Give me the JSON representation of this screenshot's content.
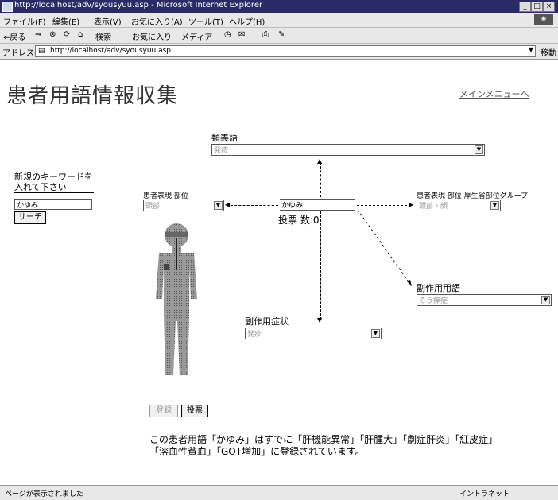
{
  "window": {
    "title": "http://localhost/adv/syousyuu.asp - Microsoft Internet Explorer",
    "menu": [
      "ファイル(F)",
      "編集(E)",
      "表示(V)",
      "お気に入り(A)",
      "ツール(T)",
      "ヘルプ(H)"
    ],
    "toolbar": [
      "⇐戻る",
      "⇒",
      "検索",
      "お気に入り",
      "メディア"
    ],
    "address_label": "アドレス(D)",
    "url": "http://localhost/adv/syousyuu.asp",
    "go_label": "移動"
  },
  "page": {
    "title": "患者用語情報収集",
    "main_menu_link": "メインメニューへ",
    "keyword_prompt": "新規のキーワードを入れて下さい",
    "keyword_value": "かゆみ",
    "search_button": "サーチ",
    "synonym_label": "類義語",
    "synonym_value": "発疹",
    "patient_part_label": "患者表現 部位",
    "patient_part_value": "頭部",
    "center_term": "かゆみ",
    "vote_count_text": "投票 数:0",
    "group_label": "患者表現 部位 厚生省部位グループ",
    "group_value": "頭部・顔",
    "side_effect_term_label": "副作用用語",
    "side_effect_term_value": "そう痒症",
    "side_effect_symptom_label": "副作用症状",
    "side_effect_symptom_value": "発疹",
    "register_button": "登録",
    "vote_button": "投票",
    "message_line1": "この患者用語「かゆみ」はすでに「肝機能異常」「肝腫大」「劇症肝炎」「紅皮症」",
    "message_line2": "「溶血性貧血」「GOT増加」に登録されています。"
  },
  "status": {
    "left": "ページが表示されました",
    "right": "イントラネット"
  }
}
